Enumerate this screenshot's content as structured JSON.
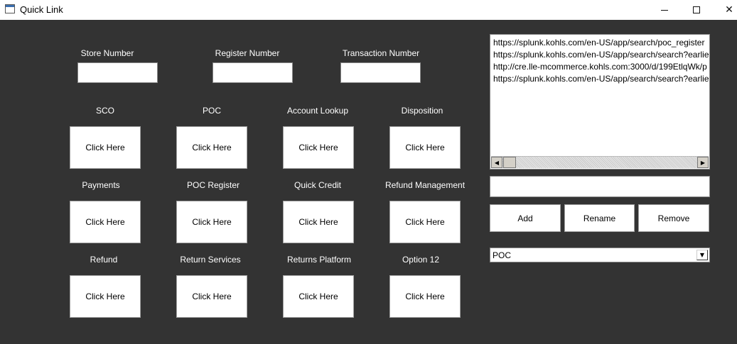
{
  "window": {
    "title": "Quick Link",
    "minimize_glyph": "",
    "maximize_glyph": "",
    "close_glyph": "✕"
  },
  "fields": {
    "store_number": {
      "label": "Store Number",
      "value": ""
    },
    "register_number": {
      "label": "Register Number",
      "value": ""
    },
    "transaction_number": {
      "label": "Transaction Number",
      "value": ""
    }
  },
  "buttons": [
    {
      "label": "SCO",
      "button_text": "Click Here"
    },
    {
      "label": "POC",
      "button_text": "Click Here"
    },
    {
      "label": "Account Lookup",
      "button_text": "Click Here"
    },
    {
      "label": "Disposition",
      "button_text": "Click Here"
    },
    {
      "label": "Payments",
      "button_text": "Click Here"
    },
    {
      "label": "POC Register",
      "button_text": "Click Here"
    },
    {
      "label": "Quick Credit",
      "button_text": "Click Here"
    },
    {
      "label": "Refund Management",
      "button_text": "Click Here"
    },
    {
      "label": "Refund",
      "button_text": "Click Here"
    },
    {
      "label": "Return Services",
      "button_text": "Click Here"
    },
    {
      "label": "Returns Platform",
      "button_text": "Click Here"
    },
    {
      "label": "Option 12",
      "button_text": "Click Here"
    }
  ],
  "links_list": {
    "items": [
      "https://splunk.kohls.com/en-US/app/search/poc_register",
      "https://splunk.kohls.com/en-US/app/search/search?earlie",
      "http://cre.lle-mcommerce.kohls.com:3000/d/199EtlqWk/p",
      "https://splunk.kohls.com/en-US/app/search/search?earlie"
    ],
    "scroll_left_glyph": "◀",
    "scroll_right_glyph": "▶"
  },
  "name_entry": {
    "value": ""
  },
  "actions": {
    "add": "Add",
    "rename": "Rename",
    "remove": "Remove"
  },
  "category_select": {
    "selected": "POC",
    "arrow_glyph": "▼"
  },
  "colors": {
    "background": "#333333",
    "titlebar": "#ffffff",
    "label_text": "#ffffff"
  }
}
